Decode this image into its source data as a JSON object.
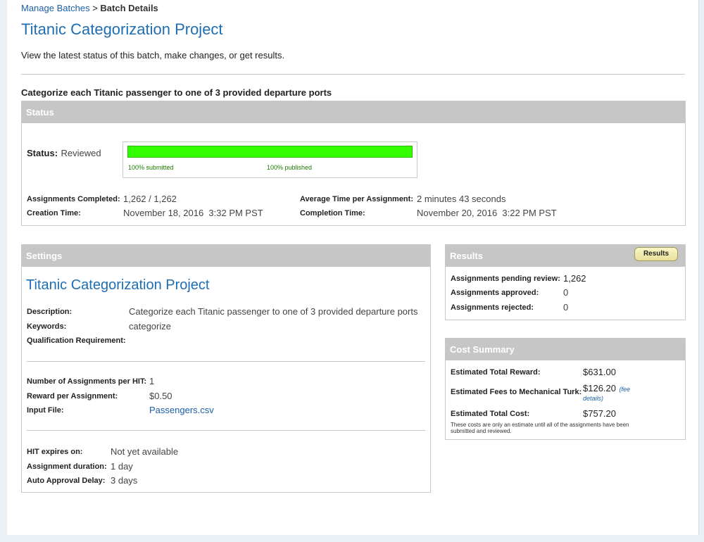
{
  "breadcrumb": {
    "parent": "Manage Batches",
    "separator": ">",
    "current": "Batch Details"
  },
  "page_title": "Titanic Categorization Project",
  "intro": "View the latest status of this batch, make changes, or get results.",
  "task_heading": "Categorize each Titanic passenger to one of 3 provided departure ports",
  "status_panel": {
    "header": "Status",
    "status_label": "Status:",
    "status_value": "Reviewed",
    "progress": {
      "submitted_percent": 100,
      "published_percent": 100,
      "submitted_label": "100% submitted",
      "published_label": "100% published"
    },
    "assignments_completed_label": "Assignments Completed:",
    "assignments_completed_value": "1,262 / 1,262",
    "creation_time_label": "Creation Time:",
    "creation_time_value": "November 18, 2016  3:32 PM PST",
    "avg_time_label": "Average Time per Assignment:",
    "avg_time_value": "2 minutes 43 seconds",
    "completion_time_label": "Completion Time:",
    "completion_time_value": "November 20, 2016  3:22 PM PST"
  },
  "settings_panel": {
    "header": "Settings",
    "title": "Titanic Categorization Project",
    "description_label": "Description:",
    "description_value": "Categorize each Titanic passenger to one of 3 provided departure ports",
    "keywords_label": "Keywords:",
    "keywords_value": "categorize",
    "qualification_label": "Qualification Requirement:",
    "assignments_per_hit_label": "Number of Assignments per HIT:",
    "assignments_per_hit_value": "1",
    "reward_label": "Reward per Assignment:",
    "reward_value": "$0.50",
    "input_file_label": "Input File:",
    "input_file_value": "Passengers.csv",
    "expires_label": "HIT expires on:",
    "expires_value": "Not yet available",
    "duration_label": "Assignment duration:",
    "duration_value": "1 day",
    "auto_approval_label": "Auto Approval Delay:",
    "auto_approval_value": "3 days"
  },
  "results_panel": {
    "header": "Results",
    "button_label": "Results",
    "pending_label": "Assignments pending review:",
    "pending_value": "1,262",
    "approved_label": "Assignments approved:",
    "approved_value": "0",
    "rejected_label": "Assignments rejected:",
    "rejected_value": "0"
  },
  "cost_panel": {
    "header": "Cost Summary",
    "reward_label": "Estimated Total Reward:",
    "reward_value": "$631.00",
    "fees_label": "Estimated Fees to Mechanical Turk:",
    "fees_value": "$126.20",
    "fee_details_open": "(fee",
    "fee_details_close": "details)",
    "total_label": "Estimated Total Cost:",
    "total_value": "$757.20",
    "note_line1": "These costs are only an estimate until all of the assignments have been",
    "note_line2": "submitted and reviewed."
  },
  "colors": {
    "link": "#1a5fa8",
    "title": "#1f6eb3",
    "panel_header": "#c6c6c6",
    "progress": "#33ff00",
    "progress_text": "#1a7d00"
  }
}
